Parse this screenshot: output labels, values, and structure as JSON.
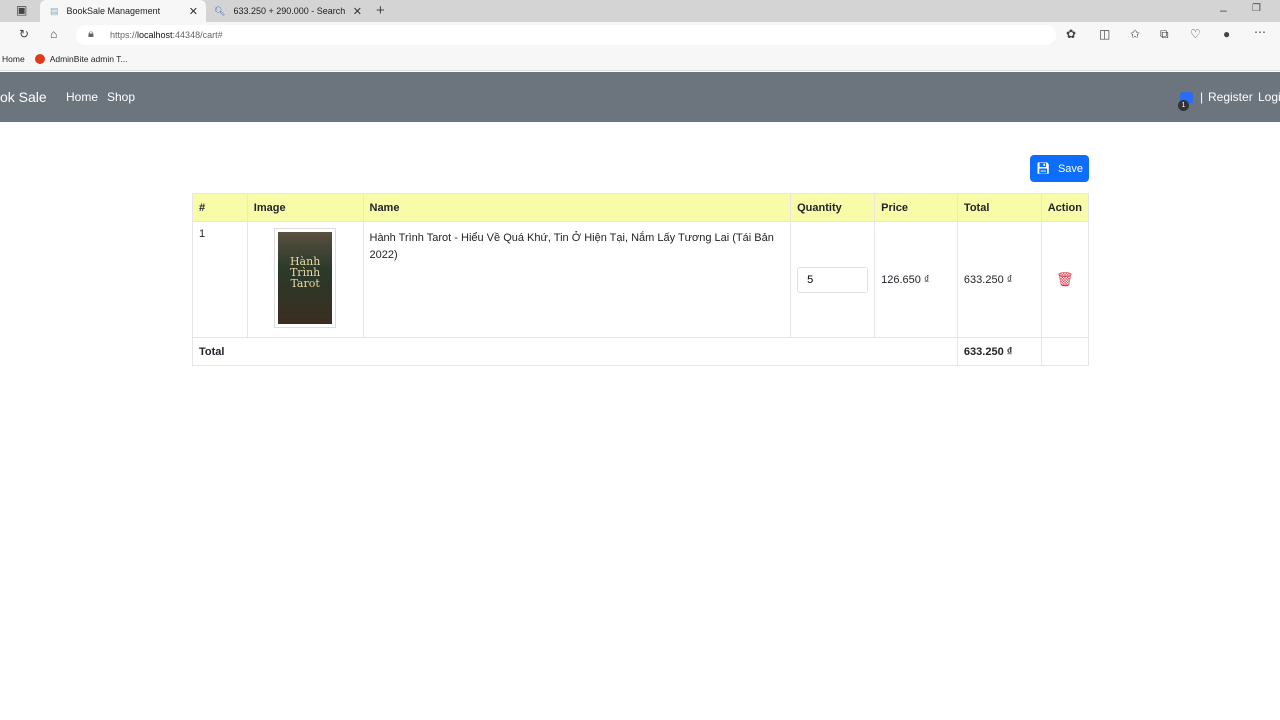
{
  "browser": {
    "tabs": [
      {
        "title": "BookSale Management"
      },
      {
        "title": "633.250 + 290.000 - Search"
      }
    ],
    "url_prefix": "https://",
    "url_host": "localhost",
    "url_rest": ":44348/cart#",
    "bookmarks": [
      "Home",
      "AdminBite admin T..."
    ]
  },
  "navbar": {
    "brand": "ok Sale",
    "links": [
      "Home",
      "Shop"
    ],
    "cart_count": "1",
    "register": "Register",
    "login": "Logi"
  },
  "save_label": "Save",
  "table": {
    "headers": [
      "#",
      "Image",
      "Name",
      "Quantity",
      "Price",
      "Total",
      "Action"
    ],
    "rows": [
      {
        "index": "1",
        "cover_text": "Hành Trình Tarot",
        "name": "Hành Trình Tarot - Hiểu Về Quá Khứ, Tin Ở Hiện Tại, Nắm Lấy Tương Lai (Tái Bản 2022)",
        "quantity": "5",
        "price": "126.650 ₫",
        "total": "633.250 ₫"
      }
    ],
    "total_label": "Total",
    "grand_total": "633.250 ₫"
  },
  "colors": {
    "navbar": "#6c757d",
    "primary": "#0d6efd",
    "header": "#f8fca8",
    "danger": "#dc3545"
  }
}
